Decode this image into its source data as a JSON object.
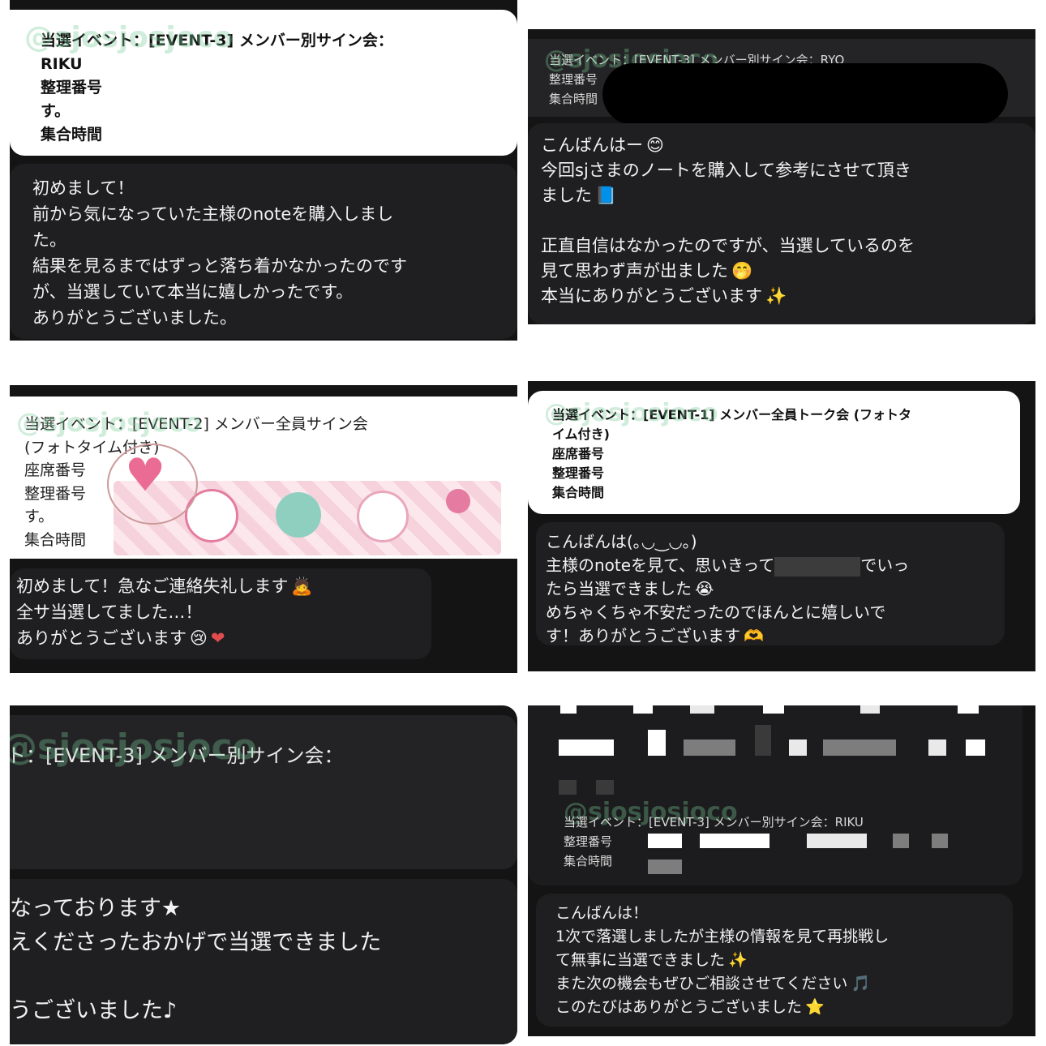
{
  "watermark": "@sjosjosjoco",
  "panels": [
    {
      "header": {
        "event": "当選イベント：[EVENT-3] メンバー別サイン会：",
        "member": "RIKU",
        "field1": "整理番号",
        "field1_suffix": "す。",
        "field2": "集合時間"
      },
      "message": [
        "初めまして！",
        "前から気になっていた主様のnoteを購入しまし",
        "た。",
        "結果を見るまではずっと落ち着かなかったのです",
        "が、当選していて本当に嬉しかったです。",
        "ありがとうございました。"
      ]
    },
    {
      "header": {
        "event": "当選イベント：[EVENT-3] メンバー別サイン会：RYO",
        "field1": "整理番号",
        "field2": "集合時間"
      },
      "message": [
        "こんばんはー",
        "今回sjさまのノートを購入して参考にさせて頂き",
        "ました",
        "",
        "正直自信はなかったのですが、当選しているのを",
        "見て思わず声が出ました",
        "本当にありがとうございます"
      ],
      "emojis": [
        "😊",
        "📘",
        "🤭",
        "✨"
      ]
    },
    {
      "header": {
        "event": "当選イベント：[EVENT-2] メンバー全員サイン会",
        "event2": "(フォトタイム付き)",
        "field1": "座席番号",
        "field2": "整理番号",
        "field2_suffix": "す。",
        "field3": "集合時間"
      },
      "message": [
        "初めまして！急なご連絡失礼します",
        "全サ当選してました…！",
        "ありがとうございます"
      ],
      "emojis": [
        "🙇",
        "😢",
        "❤"
      ]
    },
    {
      "header": {
        "event": "当選イベント：[EVENT-1] メンバー全員トーク会 (フォトタ",
        "event2": "イム付き)",
        "field1": "座席番号",
        "field2": "整理番号",
        "field3": "集合時間"
      },
      "message": [
        "こんばんは(｡◡‿◡｡)",
        "主様のnoteを見て、思いきって",
        "たら当選できました",
        "めちゃくちゃ不安だったのでほんとに嬉しいで",
        "す！ありがとうございます"
      ],
      "message_tail": "でいっ",
      "emojis": [
        "😭",
        "🫶"
      ]
    },
    {
      "header": {
        "event": "ト：[EVENT-3] メンバー別サイン会："
      },
      "message": [
        "なっております★",
        "えくださったおかげで当選できました",
        "",
        "うございました♪"
      ]
    },
    {
      "header": {
        "event": "当選イベント：[EVENT-3] メンバー別サイン会：RIKU",
        "field1": "整理番号",
        "field2": "集合時間"
      },
      "message": [
        "こんばんは！",
        "1次で落選しましたが主様の情報を見て再挑戦し",
        "て無事に当選できました",
        "また次の機会もぜひご相談させてください",
        "このたびはありがとうございました"
      ],
      "emojis": [
        "✨",
        "🎵",
        "⭐"
      ]
    }
  ]
}
